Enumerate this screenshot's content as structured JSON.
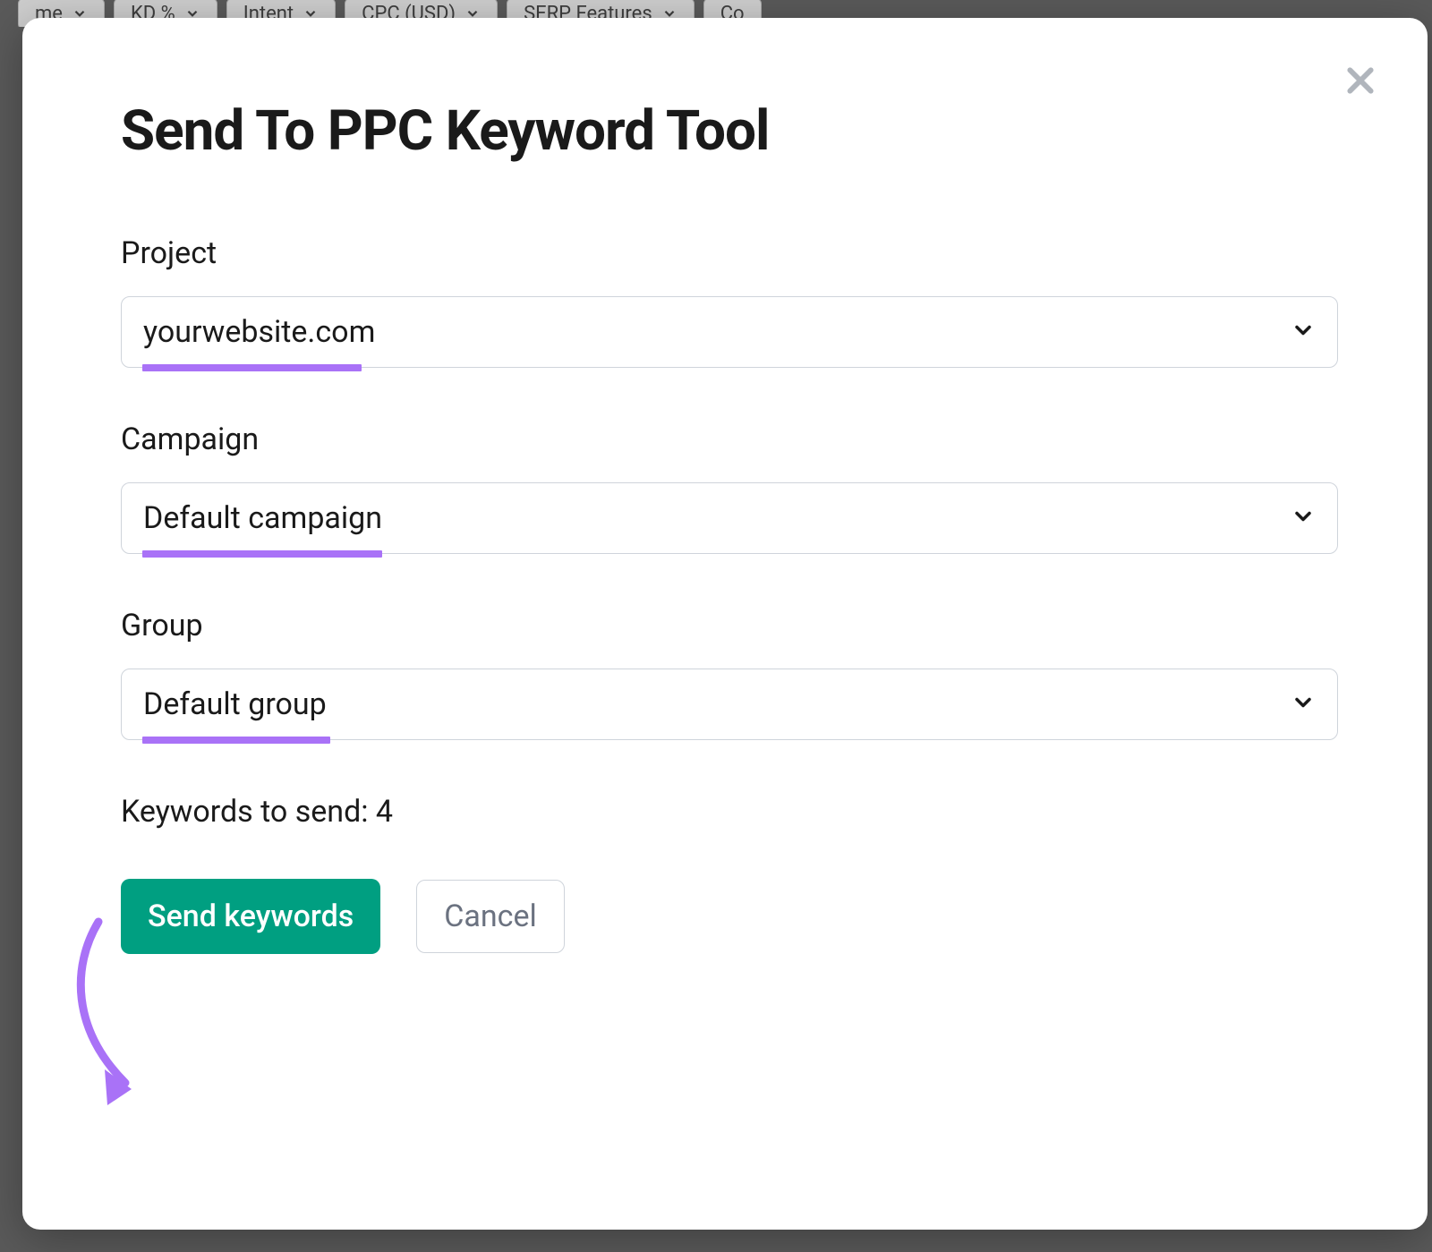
{
  "bg_filters": [
    "me",
    "KD %",
    "Intent",
    "CPC (USD)",
    "SERP Features",
    "Co"
  ],
  "modal": {
    "title": "Send To PPC Keyword Tool",
    "fields": {
      "project": {
        "label": "Project",
        "value": "yourwebsite.com"
      },
      "campaign": {
        "label": "Campaign",
        "value": "Default campaign"
      },
      "group": {
        "label": "Group",
        "value": "Default group"
      }
    },
    "keywords_label": "Keywords to send: ",
    "keywords_count": "4",
    "buttons": {
      "send": "Send keywords",
      "cancel": "Cancel"
    }
  },
  "annotation": {
    "underline_color": "#a972f7",
    "arrow_color": "#a972f7"
  }
}
